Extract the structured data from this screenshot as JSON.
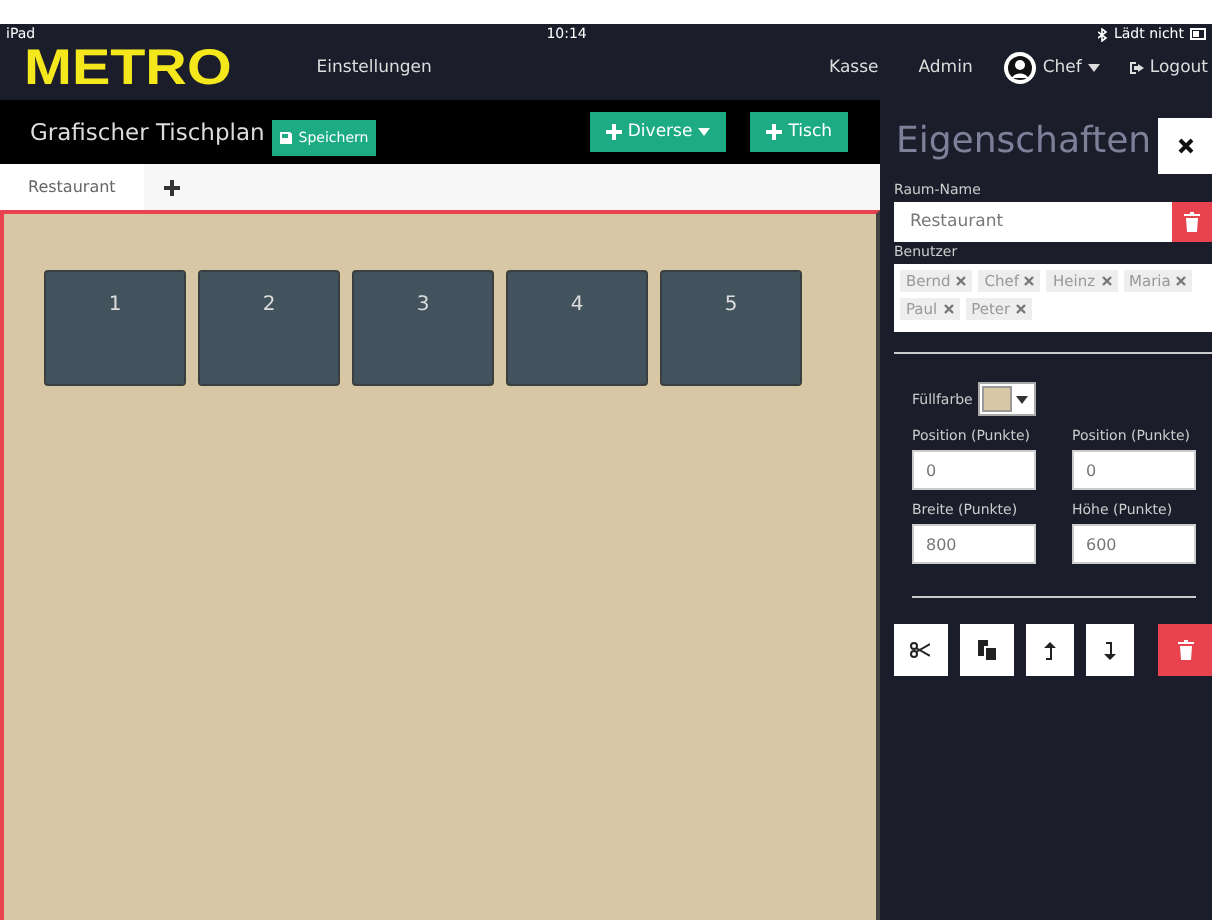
{
  "status_bar": {
    "device": "iPad",
    "time": "10:14",
    "battery": "Lädt nicht"
  },
  "nav": {
    "logo": "METRO",
    "links": [
      "Einstellungen",
      "Kasse",
      "Admin"
    ],
    "user": "Chef",
    "logout": "Logout"
  },
  "toolbar": {
    "title": "Grafischer Tischplan",
    "save": "Speichern",
    "buttons": [
      {
        "label": "Diverse",
        "kind": "dropdown"
      },
      {
        "label": "Tisch",
        "kind": "add"
      }
    ]
  },
  "tabs": [
    {
      "label": "Restaurant",
      "selected": true
    }
  ],
  "tables": [
    "1",
    "2",
    "3",
    "4",
    "5"
  ],
  "panel": {
    "title": "Eigenschaften",
    "room_label": "Raum-Name",
    "room_name": "Restaurant",
    "users_label": "Benutzer",
    "users": [
      "Bernd",
      "Chef",
      "Heinz",
      "Maria",
      "Paul",
      "Peter"
    ],
    "fill_label": "Füllfarbe",
    "fields": [
      {
        "label": "Position (Punkte)",
        "value": "0"
      },
      {
        "label": "Position (Punkte)",
        "value": "0"
      },
      {
        "label": "Breite (Punkte)",
        "value": "800"
      },
      {
        "label": "Höhe (Punkte)",
        "value": "600"
      }
    ]
  }
}
